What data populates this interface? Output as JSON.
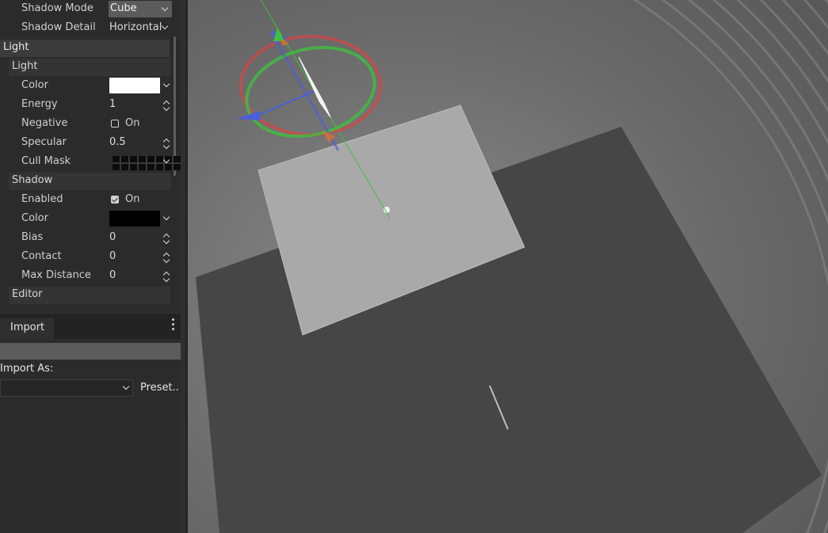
{
  "inspector": {
    "shadow_mode_label": "Shadow Mode",
    "shadow_mode_value": "Cube",
    "shadow_detail_label": "Shadow Detail",
    "shadow_detail_value": "Horizontal",
    "light_section": "Light",
    "light_subsection": "Light",
    "color_label": "Color",
    "light_color": "#ffffff",
    "energy_label": "Energy",
    "energy_value": "1",
    "negative_label": "Negative",
    "negative_on_label": "On",
    "specular_label": "Specular",
    "specular_value": "0.5",
    "cull_mask_label": "Cull Mask",
    "shadow_subsection": "Shadow",
    "enabled_label": "Enabled",
    "enabled_on_label": "On",
    "shadow_color_label": "Color",
    "shadow_color": "#000000",
    "bias_label": "Bias",
    "bias_value": "0",
    "contact_label": "Contact",
    "contact_value": "0",
    "max_distance_label": "Max Distance",
    "max_distance_value": "0",
    "editor_subsection": "Editor"
  },
  "import_dock": {
    "tab_label": "Import",
    "import_as_label": "Import As:",
    "preset_label": "Preset.."
  },
  "gizmo_colors": {
    "x_axis": "#d94545",
    "y_axis": "#3fbf3f",
    "z_axis": "#4a5fd9"
  }
}
